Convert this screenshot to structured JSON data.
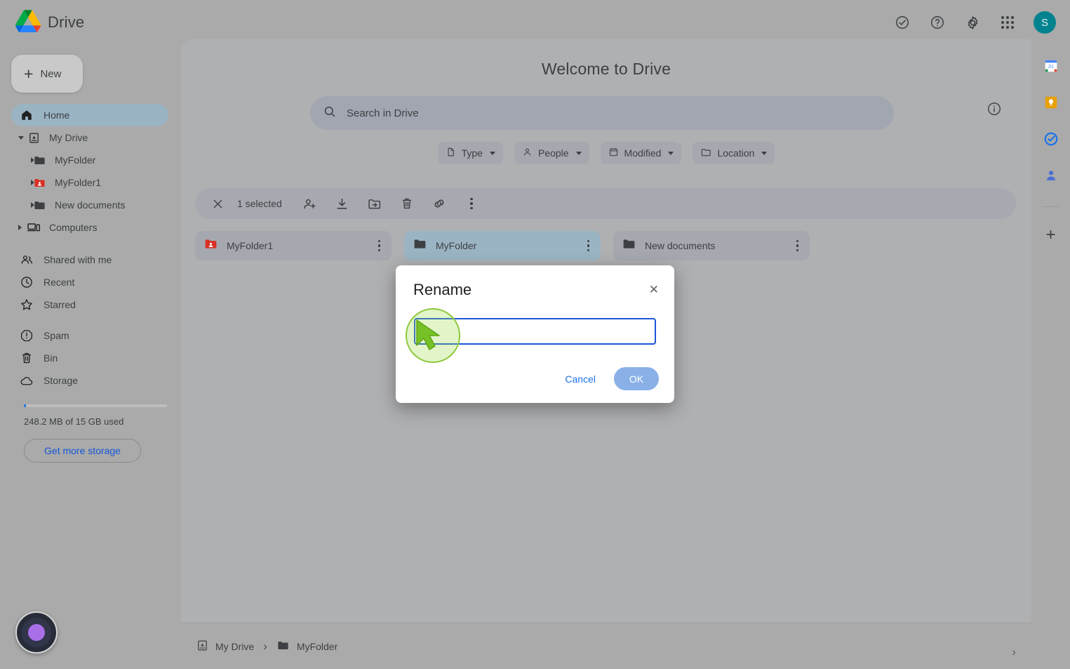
{
  "app": {
    "brand_name": "Drive",
    "logo": "drive-logo"
  },
  "topbar": {
    "icons": [
      {
        "name": "activity-check-icon",
        "glyph": "check-circle"
      },
      {
        "name": "help-icon",
        "glyph": "question-circle"
      },
      {
        "name": "settings-icon",
        "glyph": "gear"
      },
      {
        "name": "apps-grid-icon",
        "glyph": "grid-dots"
      }
    ],
    "avatar_initial": "S"
  },
  "sidebar": {
    "new_button": "New",
    "items": [
      {
        "label": "Home",
        "icon": "home-icon",
        "active": true
      },
      {
        "label": "My Drive",
        "icon": "my-drive-icon",
        "expanded": true
      },
      {
        "label": "MyFolder",
        "icon": "folder-icon",
        "child": true
      },
      {
        "label": "MyFolder1",
        "icon": "shared-folder-icon",
        "child": true
      },
      {
        "label": "New documents",
        "icon": "folder-icon",
        "child": true
      },
      {
        "label": "Computers",
        "icon": "computers-icon"
      },
      {
        "label": "Shared with me",
        "icon": "people-icon"
      },
      {
        "label": "Recent",
        "icon": "clock-icon"
      },
      {
        "label": "Starred",
        "icon": "star-icon"
      },
      {
        "label": "Spam",
        "icon": "spam-icon"
      },
      {
        "label": "Bin",
        "icon": "trash-icon"
      },
      {
        "label": "Storage",
        "icon": "cloud-icon"
      }
    ],
    "storage_text": "248.2 MB of 15 GB used",
    "storage_percent": 1.6,
    "get_more_storage": "Get more storage"
  },
  "right_rail": {
    "icons": [
      {
        "name": "google-calendar-icon"
      },
      {
        "name": "google-keep-icon"
      },
      {
        "name": "google-tasks-icon"
      },
      {
        "name": "google-contacts-icon"
      },
      {
        "name": "add-addon-icon",
        "glyph": "+"
      }
    ]
  },
  "main": {
    "page_title": "Welcome to Drive",
    "info_icon": "info-icon",
    "search": {
      "placeholder": "Search in Drive",
      "icon": "search-icon"
    },
    "filter_chips": [
      {
        "label": "Type",
        "icon": "file-icon"
      },
      {
        "label": "People",
        "icon": "person-icon"
      },
      {
        "label": "Modified",
        "icon": "calendar-icon"
      },
      {
        "label": "Location",
        "icon": "folder-icon"
      }
    ],
    "selection_toolbar": {
      "close_icon": "close-icon",
      "count_label": "1 selected",
      "actions": [
        {
          "name": "share-icon"
        },
        {
          "name": "download-icon"
        },
        {
          "name": "move-to-folder-icon"
        },
        {
          "name": "delete-icon"
        },
        {
          "name": "copy-link-icon"
        },
        {
          "name": "more-options-icon"
        }
      ]
    },
    "folder_cards": [
      {
        "name": "MyFolder1",
        "icon": "shared-folder-icon",
        "selected": false
      },
      {
        "name": "MyFolder",
        "icon": "folder-icon",
        "selected": true
      },
      {
        "name": "New documents",
        "icon": "folder-icon",
        "selected": false
      }
    ]
  },
  "breadcrumb": {
    "items": [
      {
        "label": "My Drive",
        "icon": "my-drive-icon"
      },
      {
        "label": "MyFolder",
        "icon": "folder-icon"
      }
    ],
    "separator": "›",
    "next_chevron": "›"
  },
  "recorder": {
    "name": "recording-indicator",
    "accent": "#a96fe8"
  },
  "modal": {
    "title": "Rename",
    "close_icon": "close-icon",
    "input_value": "",
    "input_placeholder": "",
    "cancel_label": "Cancel",
    "ok_label": "OK",
    "ok_color": "#8ab0e8"
  },
  "colors": {
    "page_bg": "#aaaaaa",
    "panel_bg": "#afb0b2",
    "accent_blue": "#1a73e8",
    "selected_card": "#9bb4c4",
    "avatar_bg": "#00838f",
    "highlight_green": "#8ec73c",
    "shared_folder_red": "#d93025"
  }
}
